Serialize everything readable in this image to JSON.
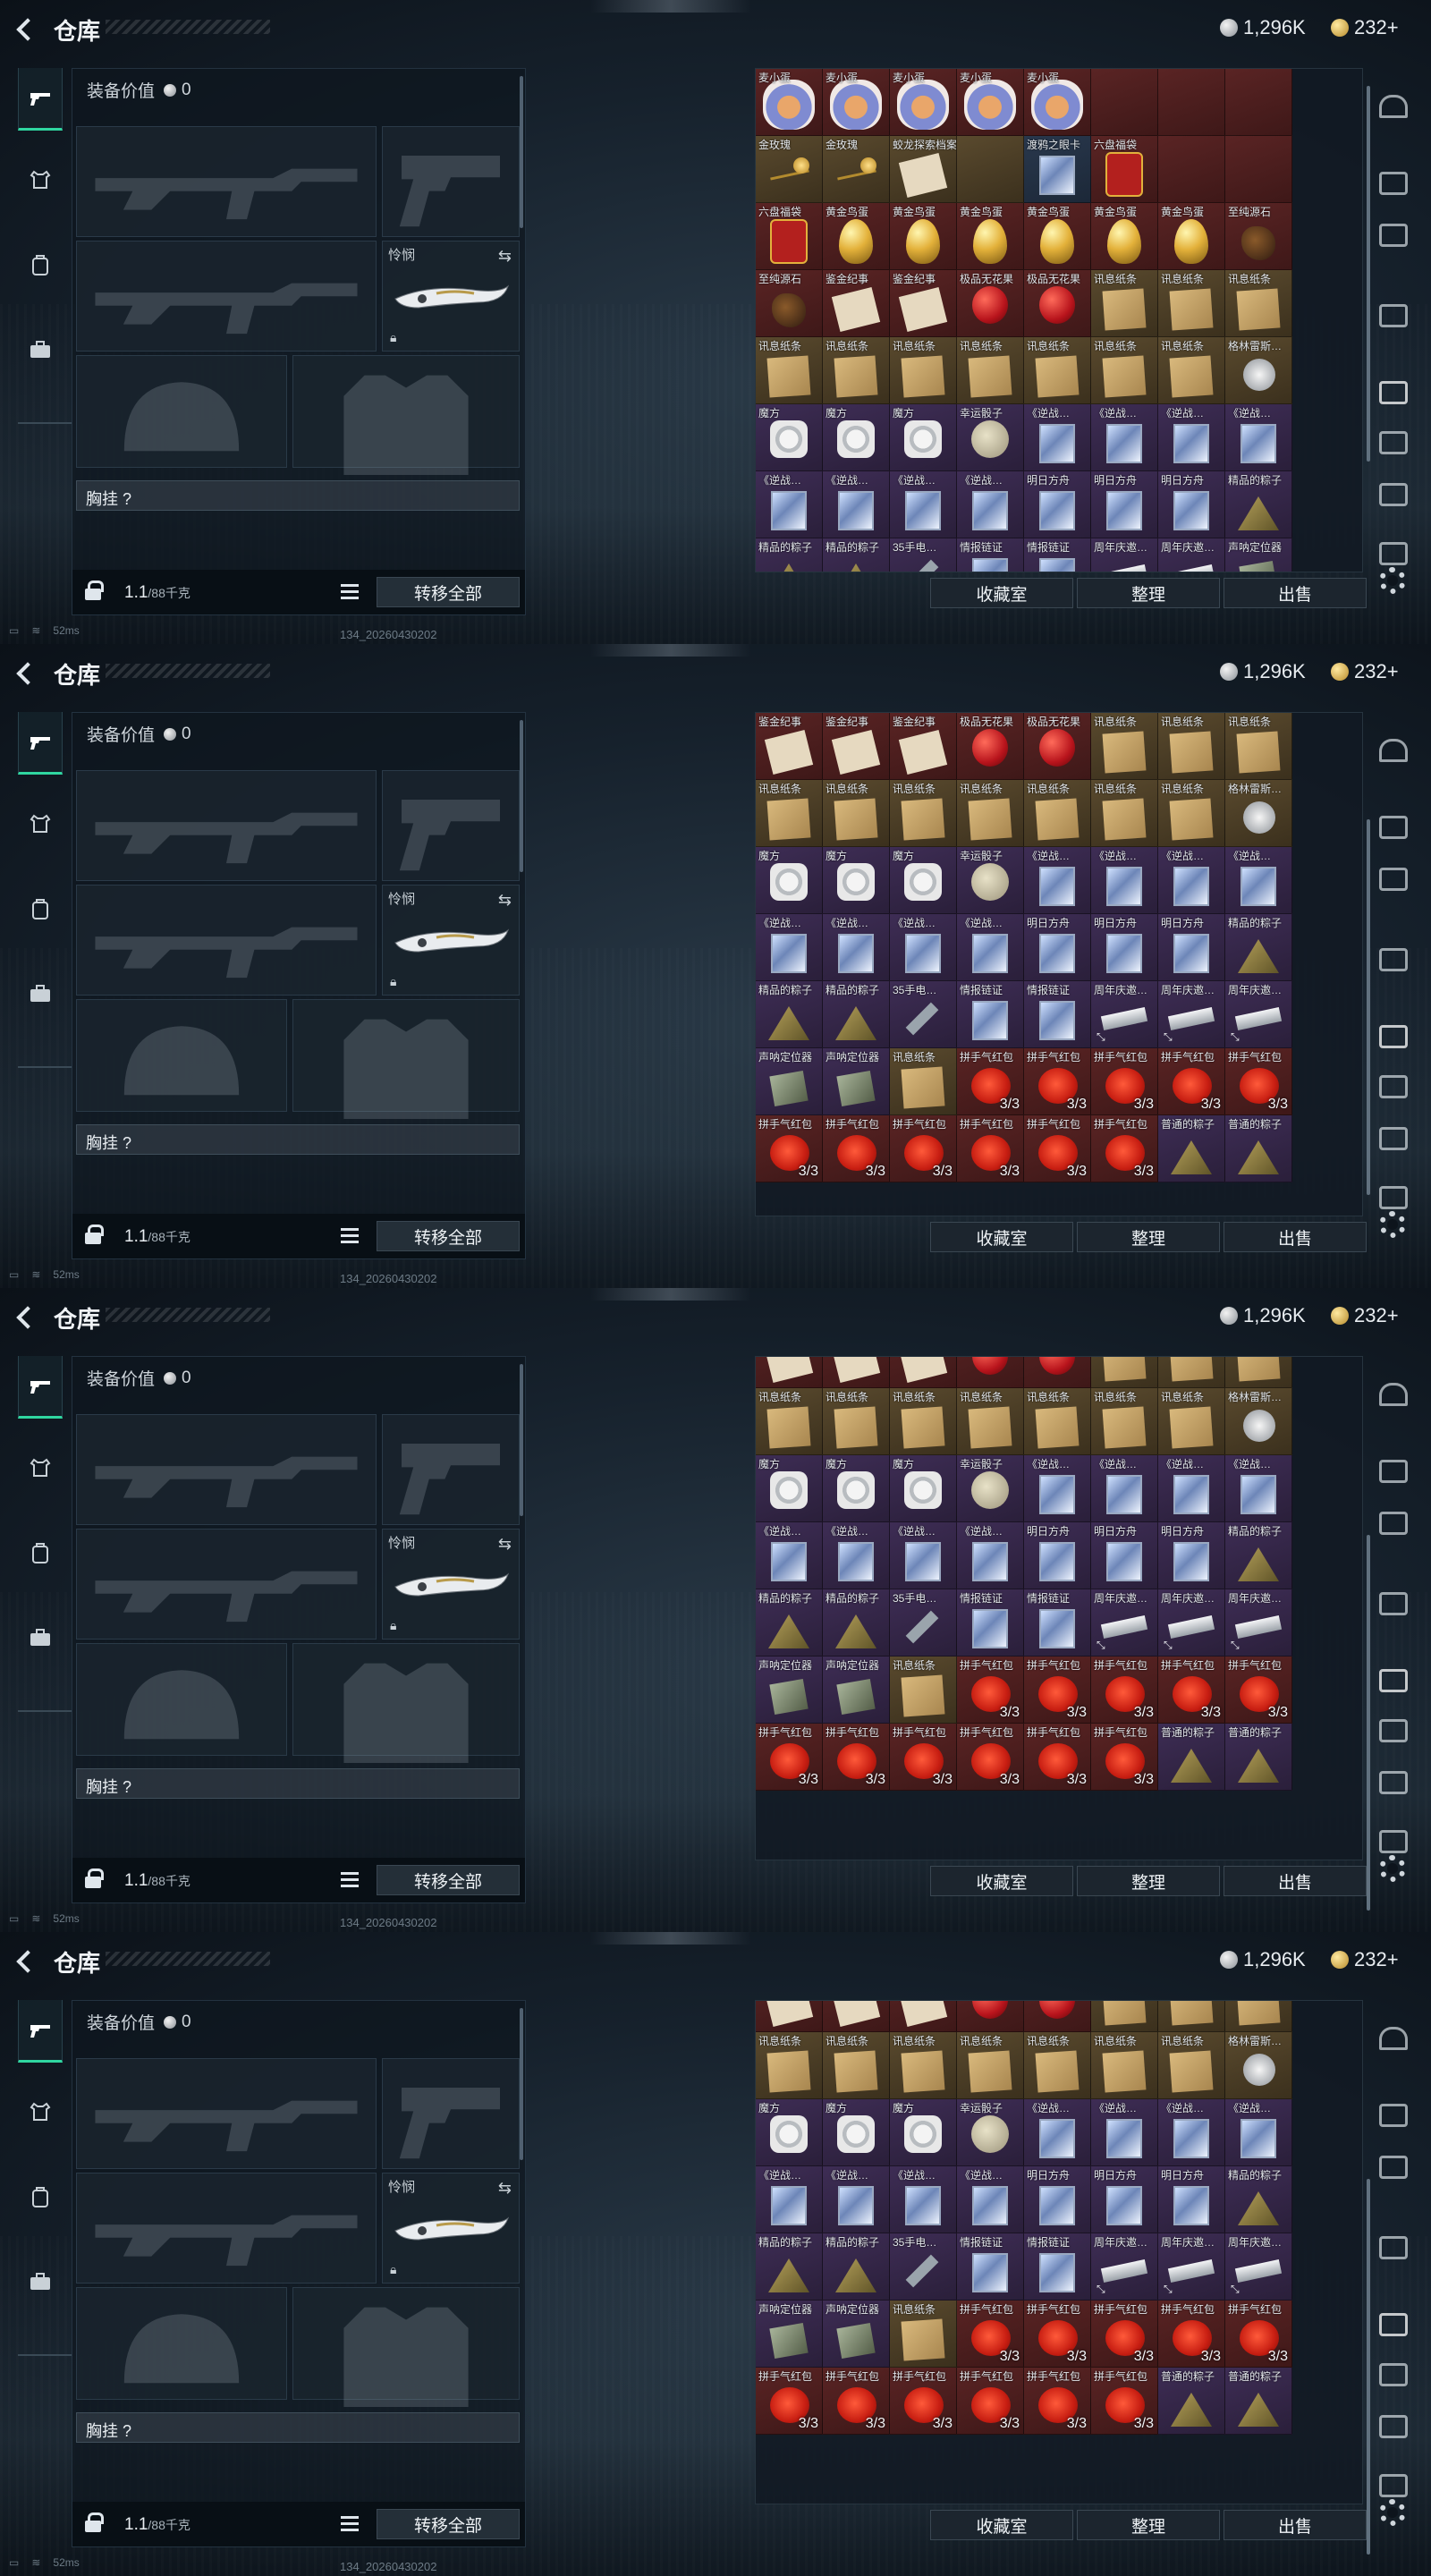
{
  "header": {
    "title": "仓库",
    "currency_silver": "1,296K",
    "currency_gold": "232+"
  },
  "loadout": {
    "equip_value_label": "装备价值",
    "equip_value": "0",
    "melee_label": "怜悯",
    "vest_label": "胸挂 ?",
    "weight": "1.1",
    "weight_capacity": "/88千克",
    "transfer_all": "转移全部"
  },
  "inventory_buttons": {
    "collection": "收藏室",
    "sort": "整理",
    "sell": "出售"
  },
  "status": {
    "ping": "52ms",
    "build": "134_20260430202"
  },
  "sidebar": {
    "tabs": [
      "weapon-tab",
      "equipment-tab",
      "backpack-tab",
      "briefcase-tab"
    ],
    "rail": [
      "shelter-icon",
      "gti-icon",
      "gti-icon",
      "gti-icon",
      "iv-icon",
      "iv-icon",
      "iv-icon",
      "image-icon"
    ]
  },
  "colors": {
    "accent": "#2fd6a0",
    "rarity_red": "#5a2424",
    "rarity_gold": "#5a4a2e",
    "rarity_blue": "#29384d",
    "rarity_purple": "#3e2d55"
  },
  "frames": [
    {
      "grid": [
        [
          {
            "n": "麦小蛋",
            "a": "plushie",
            "r": "r-red"
          },
          {
            "n": "麦小蛋",
            "a": "plushie",
            "r": "r-red"
          },
          {
            "n": "麦小蛋",
            "a": "plushie",
            "r": "r-red"
          },
          {
            "n": "麦小蛋",
            "a": "plushie",
            "r": "r-red"
          },
          {
            "n": "麦小蛋",
            "a": "plushie",
            "r": "r-red"
          },
          {
            "n": "",
            "a": "",
            "r": "r-red"
          },
          {
            "n": "",
            "a": "",
            "r": "r-red"
          },
          {
            "n": "",
            "a": "",
            "r": "r-red"
          }
        ],
        [
          {
            "n": "金玫瑰",
            "a": "rose",
            "r": "r-gold"
          },
          {
            "n": "金玫瑰",
            "a": "rose",
            "r": "r-gold"
          },
          {
            "n": "蛟龙探索档案",
            "a": "letter",
            "r": "r-gold"
          },
          {
            "n": "",
            "a": "",
            "r": "r-gold"
          },
          {
            "n": "渡鸦之眼卡",
            "a": "card",
            "r": "r-blue"
          },
          {
            "n": "六盘福袋",
            "a": "bag",
            "r": "r-red"
          },
          {
            "n": "",
            "a": "",
            "r": "r-red"
          },
          {
            "n": "",
            "a": "",
            "r": "r-red"
          }
        ],
        [
          {
            "n": "六盘福袋",
            "a": "bag",
            "r": "r-red"
          },
          {
            "n": "黄金鸟蛋",
            "a": "egg",
            "r": "r-red"
          },
          {
            "n": "黄金鸟蛋",
            "a": "egg",
            "r": "r-red"
          },
          {
            "n": "黄金鸟蛋",
            "a": "egg",
            "r": "r-red"
          },
          {
            "n": "黄金鸟蛋",
            "a": "egg",
            "r": "r-red"
          },
          {
            "n": "黄金鸟蛋",
            "a": "egg",
            "r": "r-red"
          },
          {
            "n": "黄金鸟蛋",
            "a": "egg",
            "r": "r-red"
          },
          {
            "n": "至纯源石",
            "a": "stone",
            "r": "r-red"
          }
        ],
        [
          {
            "n": "至纯源石",
            "a": "stone",
            "r": "r-red"
          },
          {
            "n": "鉴金纪事",
            "a": "letter",
            "r": "r-red"
          },
          {
            "n": "鉴金纪事",
            "a": "letter",
            "r": "r-red"
          },
          {
            "n": "极品无花果",
            "a": "apple",
            "r": "r-red"
          },
          {
            "n": "极品无花果",
            "a": "apple",
            "r": "r-red"
          },
          {
            "n": "讯息纸条",
            "a": "paper",
            "r": "r-gold"
          },
          {
            "n": "讯息纸条",
            "a": "paper",
            "r": "r-gold"
          },
          {
            "n": "讯息纸条",
            "a": "paper",
            "r": "r-gold"
          }
        ],
        [
          {
            "n": "讯息纸条",
            "a": "paper",
            "r": "r-gold"
          },
          {
            "n": "讯息纸条",
            "a": "paper",
            "r": "r-gold"
          },
          {
            "n": "讯息纸条",
            "a": "paper",
            "r": "r-gold"
          },
          {
            "n": "讯息纸条",
            "a": "paper",
            "r": "r-gold"
          },
          {
            "n": "讯息纸条",
            "a": "paper",
            "r": "r-gold"
          },
          {
            "n": "讯息纸条",
            "a": "paper",
            "r": "r-gold"
          },
          {
            "n": "讯息纸条",
            "a": "paper",
            "r": "r-gold"
          },
          {
            "n": "格林雷斯…",
            "a": "badge",
            "r": "r-gold"
          }
        ],
        [
          {
            "n": "魔方",
            "a": "cube",
            "r": "r-purple"
          },
          {
            "n": "魔方",
            "a": "cube",
            "r": "r-purple"
          },
          {
            "n": "魔方",
            "a": "cube",
            "r": "r-purple"
          },
          {
            "n": "幸运骰子",
            "a": "ball",
            "r": "r-purple"
          },
          {
            "n": "《逆战…",
            "a": "card",
            "r": "r-purple"
          },
          {
            "n": "《逆战…",
            "a": "card",
            "r": "r-purple"
          },
          {
            "n": "《逆战…",
            "a": "card",
            "r": "r-purple"
          },
          {
            "n": "《逆战…",
            "a": "card",
            "r": "r-purple"
          }
        ],
        [
          {
            "n": "《逆战…",
            "a": "card",
            "r": "r-purple"
          },
          {
            "n": "《逆战…",
            "a": "card",
            "r": "r-purple"
          },
          {
            "n": "《逆战…",
            "a": "card",
            "r": "r-purple"
          },
          {
            "n": "《逆战…",
            "a": "card",
            "r": "r-purple"
          },
          {
            "n": "明日方舟",
            "a": "card",
            "r": "r-purple"
          },
          {
            "n": "明日方舟",
            "a": "card",
            "r": "r-purple"
          },
          {
            "n": "明日方舟",
            "a": "card",
            "r": "r-purple"
          },
          {
            "n": "精品的粽子",
            "a": "zongzi",
            "r": "r-purple"
          }
        ],
        [
          {
            "n": "精品的粽子",
            "a": "zongzi",
            "r": "r-purple"
          },
          {
            "n": "精品的粽子",
            "a": "zongzi",
            "r": "r-purple"
          },
          {
            "n": "35手电…",
            "a": "stick",
            "r": "r-purple"
          },
          {
            "n": "情报链证",
            "a": "card",
            "r": "r-purple"
          },
          {
            "n": "情报链证",
            "a": "card",
            "r": "r-purple"
          },
          {
            "n": "周年庆邀…",
            "a": "chip",
            "r": "r-purple"
          },
          {
            "n": "周年庆邀…",
            "a": "chip",
            "r": "r-purple"
          },
          {
            "n": "声呐定位器",
            "a": "beacon",
            "r": "r-purple"
          }
        ]
      ]
    }
  ],
  "lower_grid": [
    [
      {
        "n": "鉴金纪事",
        "a": "letter",
        "r": "r-red"
      },
      {
        "n": "鉴金纪事",
        "a": "letter",
        "r": "r-red"
      },
      {
        "n": "鉴金纪事",
        "a": "letter",
        "r": "r-red"
      },
      {
        "n": "极品无花果",
        "a": "apple",
        "r": "r-red"
      },
      {
        "n": "极品无花果",
        "a": "apple",
        "r": "r-red"
      },
      {
        "n": "讯息纸条",
        "a": "paper",
        "r": "r-gold"
      },
      {
        "n": "讯息纸条",
        "a": "paper",
        "r": "r-gold"
      },
      {
        "n": "讯息纸条",
        "a": "paper",
        "r": "r-gold"
      }
    ],
    [
      {
        "n": "讯息纸条",
        "a": "paper",
        "r": "r-gold"
      },
      {
        "n": "讯息纸条",
        "a": "paper",
        "r": "r-gold"
      },
      {
        "n": "讯息纸条",
        "a": "paper",
        "r": "r-gold"
      },
      {
        "n": "讯息纸条",
        "a": "paper",
        "r": "r-gold"
      },
      {
        "n": "讯息纸条",
        "a": "paper",
        "r": "r-gold"
      },
      {
        "n": "讯息纸条",
        "a": "paper",
        "r": "r-gold"
      },
      {
        "n": "讯息纸条",
        "a": "paper",
        "r": "r-gold"
      },
      {
        "n": "格林雷斯…",
        "a": "badge",
        "r": "r-gold"
      }
    ],
    [
      {
        "n": "魔方",
        "a": "cube",
        "r": "r-purple"
      },
      {
        "n": "魔方",
        "a": "cube",
        "r": "r-purple"
      },
      {
        "n": "魔方",
        "a": "cube",
        "r": "r-purple"
      },
      {
        "n": "幸运骰子",
        "a": "ball",
        "r": "r-purple"
      },
      {
        "n": "《逆战…",
        "a": "card",
        "r": "r-purple"
      },
      {
        "n": "《逆战…",
        "a": "card",
        "r": "r-purple"
      },
      {
        "n": "《逆战…",
        "a": "card",
        "r": "r-purple"
      },
      {
        "n": "《逆战…",
        "a": "card",
        "r": "r-purple"
      }
    ],
    [
      {
        "n": "《逆战…",
        "a": "card",
        "r": "r-purple"
      },
      {
        "n": "《逆战…",
        "a": "card",
        "r": "r-purple"
      },
      {
        "n": "《逆战…",
        "a": "card",
        "r": "r-purple"
      },
      {
        "n": "《逆战…",
        "a": "card",
        "r": "r-purple"
      },
      {
        "n": "明日方舟",
        "a": "card",
        "r": "r-purple"
      },
      {
        "n": "明日方舟",
        "a": "card",
        "r": "r-purple"
      },
      {
        "n": "明日方舟",
        "a": "card",
        "r": "r-purple"
      },
      {
        "n": "精品的粽子",
        "a": "zongzi",
        "r": "r-purple"
      }
    ],
    [
      {
        "n": "精品的粽子",
        "a": "zongzi",
        "r": "r-purple"
      },
      {
        "n": "精品的粽子",
        "a": "zongzi",
        "r": "r-purple"
      },
      {
        "n": "35手电…",
        "a": "stick",
        "r": "r-purple"
      },
      {
        "n": "情报链证",
        "a": "card",
        "r": "r-purple"
      },
      {
        "n": "情报链证",
        "a": "card",
        "r": "r-purple"
      },
      {
        "n": "周年庆邀…",
        "a": "chip",
        "r": "r-purple",
        "f": "⤡"
      },
      {
        "n": "周年庆邀…",
        "a": "chip",
        "r": "r-purple",
        "f": "⤡"
      },
      {
        "n": "周年庆邀…",
        "a": "chip",
        "r": "r-purple",
        "f": "⤡"
      }
    ],
    [
      {
        "n": "声呐定位器",
        "a": "beacon",
        "r": "r-purple"
      },
      {
        "n": "声呐定位器",
        "a": "beacon",
        "r": "r-purple"
      },
      {
        "n": "讯息纸条",
        "a": "paper",
        "r": "r-gold"
      },
      {
        "n": "拼手气红包",
        "a": "redpack",
        "r": "r-red",
        "q": "3/3"
      },
      {
        "n": "拼手气红包",
        "a": "redpack",
        "r": "r-red",
        "q": "3/3"
      },
      {
        "n": "拼手气红包",
        "a": "redpack",
        "r": "r-red",
        "q": "3/3"
      },
      {
        "n": "拼手气红包",
        "a": "redpack",
        "r": "r-red",
        "q": "3/3"
      },
      {
        "n": "拼手气红包",
        "a": "redpack",
        "r": "r-red",
        "q": "3/3"
      }
    ],
    [
      {
        "n": "拼手气红包",
        "a": "redpack",
        "r": "r-red",
        "q": "3/3"
      },
      {
        "n": "拼手气红包",
        "a": "redpack",
        "r": "r-red",
        "q": "3/3"
      },
      {
        "n": "拼手气红包",
        "a": "redpack",
        "r": "r-red",
        "q": "3/3"
      },
      {
        "n": "拼手气红包",
        "a": "redpack",
        "r": "r-red",
        "q": "3/3"
      },
      {
        "n": "拼手气红包",
        "a": "redpack",
        "r": "r-red",
        "q": "3/3"
      },
      {
        "n": "拼手气红包",
        "a": "redpack",
        "r": "r-red",
        "q": "3/3"
      },
      {
        "n": "普通的粽子",
        "a": "zongzi",
        "r": "r-purple"
      },
      {
        "n": "普通的粽子",
        "a": "zongzi",
        "r": "r-purple"
      }
    ]
  ]
}
